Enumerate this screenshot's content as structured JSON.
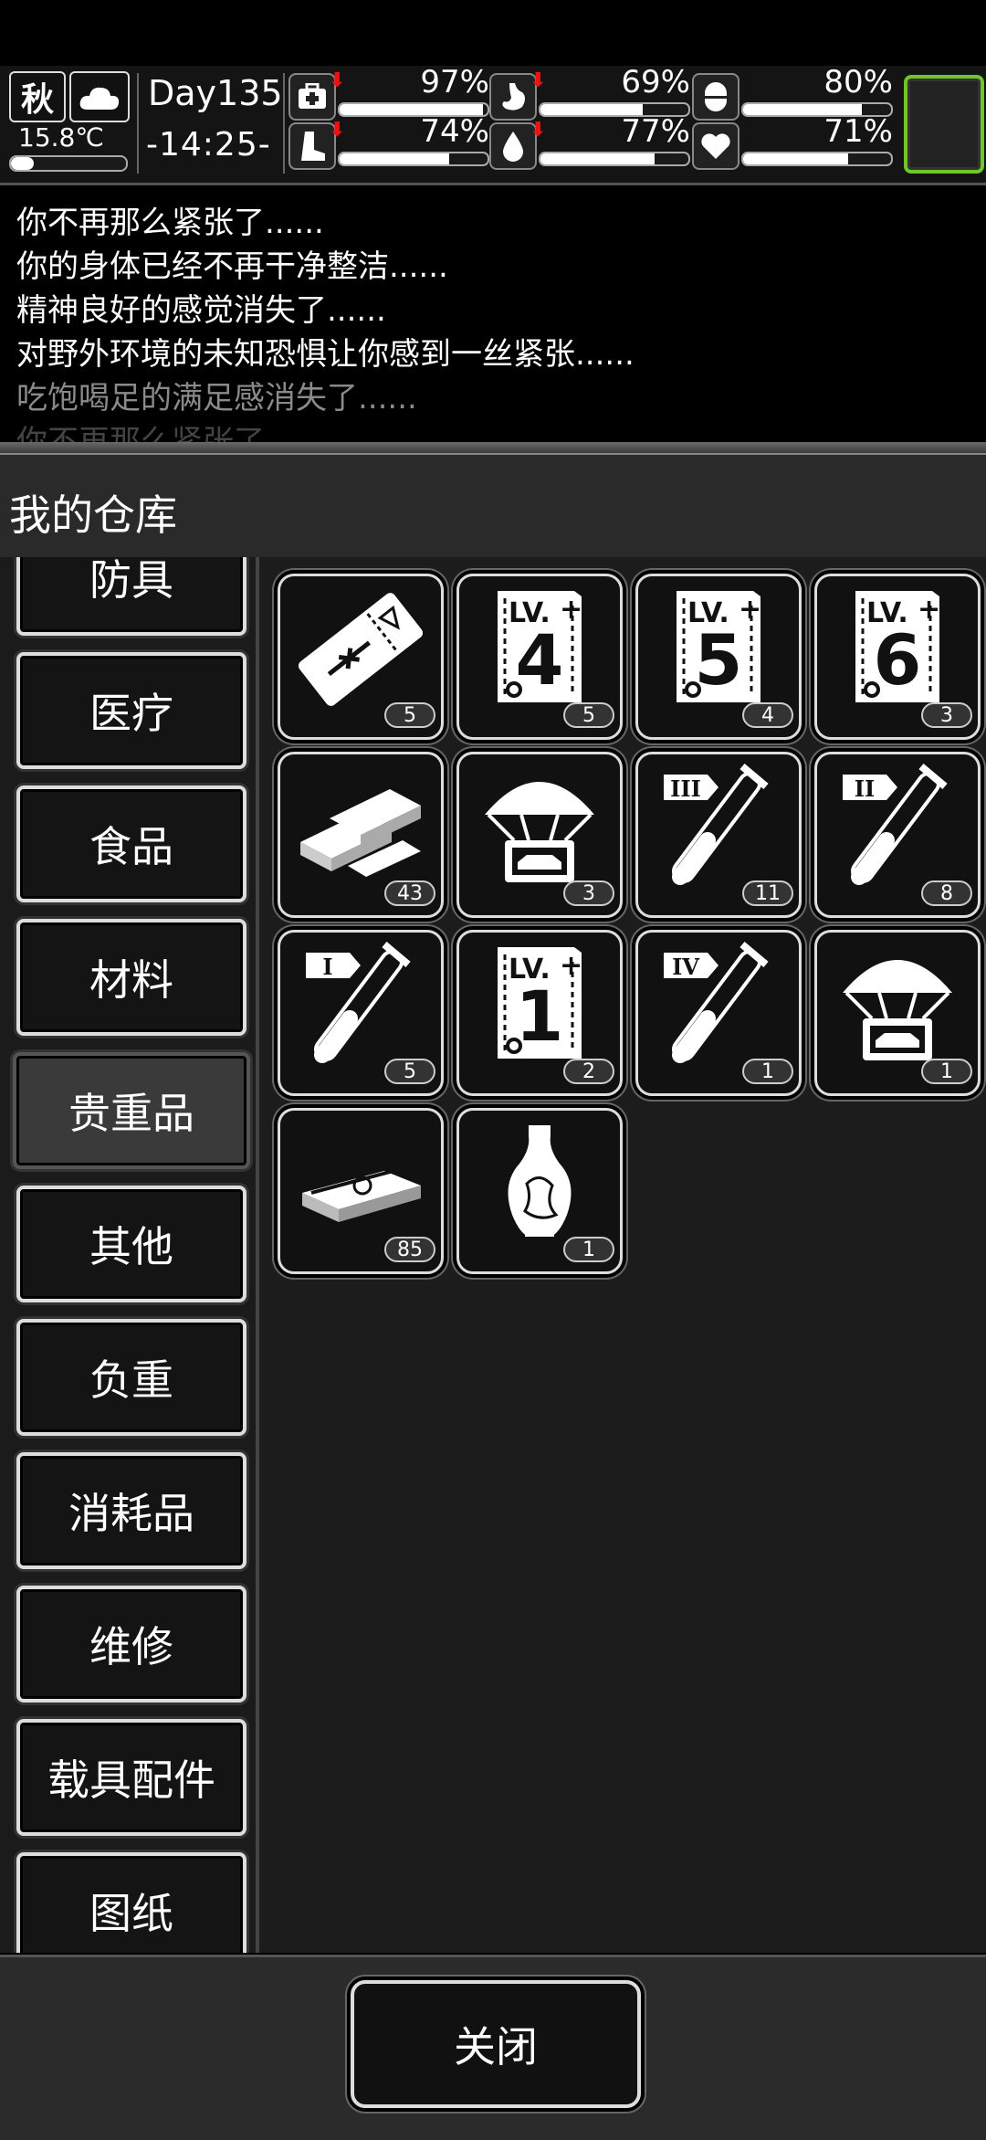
{
  "status": {
    "season": "秋",
    "weather_icon": "cloud-icon",
    "temperature": "15.8℃",
    "temperature_level": 0.2,
    "day": "Day135",
    "time": "-14:25-",
    "stats": [
      {
        "name": "health",
        "icon": "medkit-icon",
        "value": "97%",
        "level": 0.97,
        "trend": "down"
      },
      {
        "name": "hunger",
        "icon": "stomach-icon",
        "value": "69%",
        "level": 0.69,
        "trend": "down"
      },
      {
        "name": "mood",
        "icon": "capsule-icon",
        "value": "80%",
        "level": 0.8,
        "trend": "none"
      },
      {
        "name": "stamina",
        "icon": "boot-icon",
        "value": "74%",
        "level": 0.74,
        "trend": "down"
      },
      {
        "name": "thirst",
        "icon": "water-drop-icon",
        "value": "77%",
        "level": 0.77,
        "trend": "down"
      },
      {
        "name": "spirit",
        "icon": "heart-icon",
        "value": "71%",
        "level": 0.71,
        "trend": "none"
      }
    ],
    "trend_arrow": "⬇"
  },
  "log": [
    "你不再那么紧张了......",
    "你的身体已经不再干净整洁......",
    "精神良好的感觉消失了......",
    "对野外环境的未知恐惧让你感到一丝紧张......",
    "吃饱喝足的满足感消失了......",
    "你不再那么紧张了......"
  ],
  "panel": {
    "title": "我的仓库",
    "categories": [
      "防具",
      "医疗",
      "食品",
      "材料",
      "贵重品",
      "其他",
      "负重",
      "消耗品",
      "维修",
      "载具配件",
      "图纸"
    ],
    "active_category": "贵重品",
    "items": [
      {
        "icon": "voucher-ticket-icon",
        "count": "5"
      },
      {
        "icon": "skill-book-icon",
        "level": "4",
        "count": "5"
      },
      {
        "icon": "skill-book-icon",
        "level": "5",
        "count": "4"
      },
      {
        "icon": "skill-book-icon",
        "level": "6",
        "count": "3"
      },
      {
        "icon": "gold-bars-icon",
        "count": "43"
      },
      {
        "icon": "vehicle-airdrop-icon",
        "count": "3"
      },
      {
        "icon": "test-tube-icon",
        "tier": "III",
        "count": "11"
      },
      {
        "icon": "test-tube-icon",
        "tier": "II",
        "count": "8"
      },
      {
        "icon": "test-tube-icon",
        "tier": "I",
        "count": "5"
      },
      {
        "icon": "skill-book-icon",
        "level": "1",
        "count": "2"
      },
      {
        "icon": "test-tube-icon",
        "tier": "IV",
        "count": "1"
      },
      {
        "icon": "vehicle-airdrop-icon",
        "count": "1"
      },
      {
        "icon": "cash-bundle-icon",
        "count": "85"
      },
      {
        "icon": "porcelain-vase-icon",
        "count": "1"
      }
    ],
    "book_prefix": "LV.",
    "close_label": "关闭"
  },
  "colors": {
    "accent_green": "#6ec62b",
    "warning_red": "#e11111"
  }
}
